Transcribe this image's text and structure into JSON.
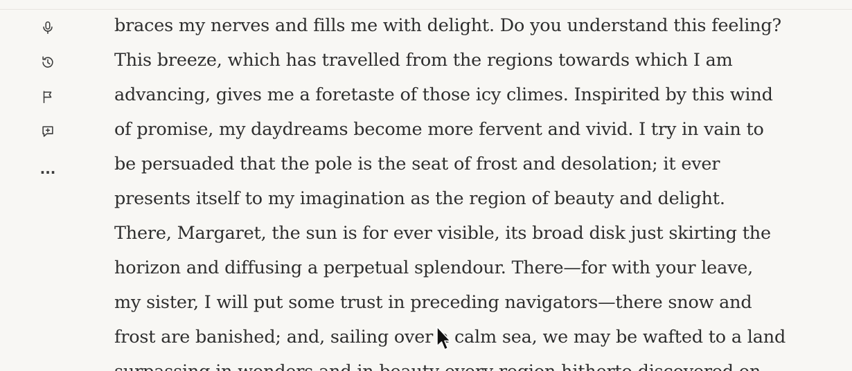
{
  "toolbar": {
    "items": [
      {
        "icon": "microphone-icon",
        "label": ""
      },
      {
        "icon": "history-icon",
        "label": ""
      },
      {
        "icon": "flag-icon",
        "label": ""
      },
      {
        "icon": "add-comment-icon",
        "label": ""
      },
      {
        "icon": "more-icon",
        "label": "..."
      }
    ]
  },
  "reader": {
    "lines": [
      "braces my nerves and fills me with delight. Do you understand this feeling?",
      "This breeze, which has travelled from the regions towards which I am",
      "advancing, gives me a foretaste of those icy climes. Inspirited by this wind",
      "of promise, my daydreams become more fervent and vivid. I try in vain to",
      "be persuaded that the pole is the seat of frost and desolation; it ever",
      "presents itself to my imagination as the region of beauty and delight.",
      "There, Margaret, the sun is for ever visible, its broad disk just skirting the",
      "horizon and diffusing a perpetual splendour. There—for with your leave,",
      "my sister, I will put some trust in preceding navigators—there snow and",
      "frost are banished; and, sailing over a calm sea, we may be wafted to a land",
      "surpassing in wonders and in beauty every region hitherto discovered on"
    ]
  },
  "colors": {
    "background": "#f8f7f4",
    "text": "#2e2e2e",
    "icon": "#3b3b3b"
  }
}
